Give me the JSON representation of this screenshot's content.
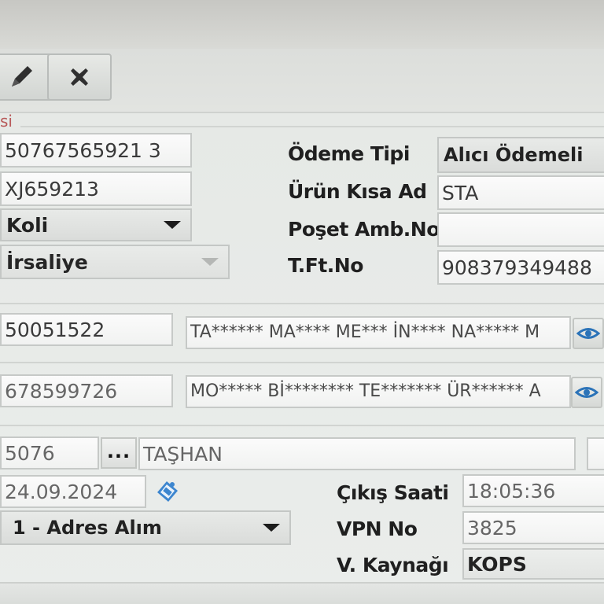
{
  "section": {
    "label": "si"
  },
  "toolbar": {
    "edit_icon": "pencil-icon",
    "delete_icon": "close-icon"
  },
  "left": {
    "barcode": "50767565921 3",
    "code": "XJ659213",
    "type_select": "Koli",
    "doc_select": "İrsaliye"
  },
  "right": {
    "payment_type_label": "Ödeme Tipi",
    "payment_type_value": "Alıcı Ödemeli",
    "product_short_label": "Ürün Kısa Ad",
    "product_short_value": "STA",
    "bag_label": "Poşet Amb.No",
    "bag_value": "",
    "tft_label": "T.Ft.No",
    "tft_value": "908379349488"
  },
  "sender": {
    "id": "50051522",
    "name_masked": "TA****** MA**** ME*** İN**** NA***** M"
  },
  "receiver": {
    "id": "678599726",
    "name_masked": "MO***** Bİ******** TE******* ÜR****** A"
  },
  "branch": {
    "code": "5076",
    "dots_label": "...",
    "name": "TAŞHAN"
  },
  "date": {
    "value": "24.09.2024"
  },
  "collection": {
    "select": "1 - Adres Alım"
  },
  "exit_time": {
    "label": "Çıkış Saati",
    "value": "18:05:36"
  },
  "vpn": {
    "label": "VPN No",
    "value": "3825"
  },
  "source": {
    "label": "V. Kaynağı",
    "value": "KOPS"
  },
  "colors": {
    "section_label": "#b85a5a",
    "eye_icon": "#2b73b8"
  }
}
